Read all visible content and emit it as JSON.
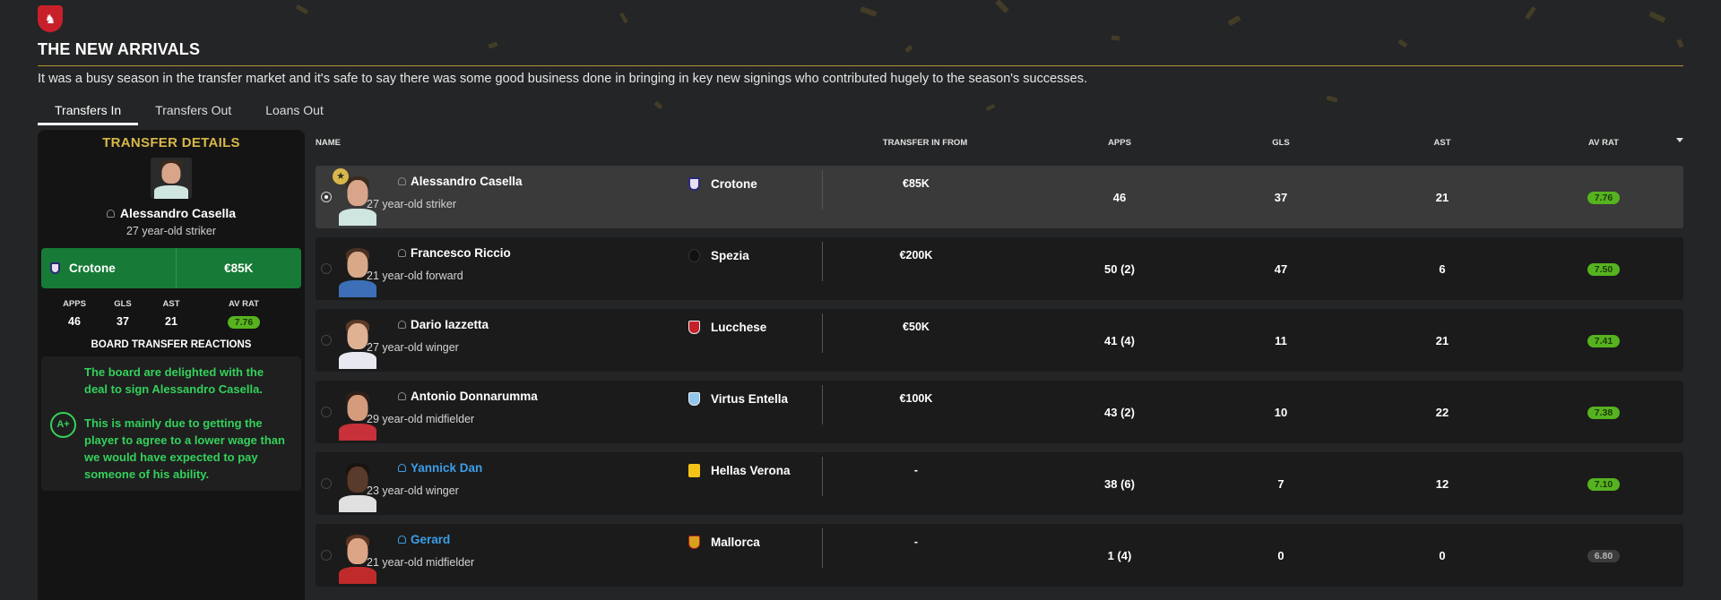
{
  "page": {
    "title": "THE NEW ARRIVALS",
    "intro": "It was a busy season in the transfer market and it's safe to say there was some good business done in bringing in key new signings who contributed hugely to the season's successes."
  },
  "tabs": [
    {
      "label": "Transfers In",
      "active": true
    },
    {
      "label": "Transfers Out",
      "active": false
    },
    {
      "label": "Loans Out",
      "active": false
    }
  ],
  "details": {
    "title": "TRANSFER DETAILS",
    "player_name": "Alessandro Casella",
    "player_desc": "27 year-old striker",
    "from_club": "Crotone",
    "fee": "€85K",
    "stats": [
      {
        "label": "APPS",
        "value": "46"
      },
      {
        "label": "GLS",
        "value": "37"
      },
      {
        "label": "AST",
        "value": "21"
      },
      {
        "label": "AV RAT",
        "value": "7.76"
      }
    ],
    "reactions_title": "BOARD TRANSFER REACTIONS",
    "grade": "A+",
    "reaction_1": "The board are delighted with the deal to sign Alessandro Casella.",
    "reaction_2": "This is mainly due to getting the player to agree to a lower wage than we would have expected to pay someone of his ability."
  },
  "table": {
    "headers": {
      "name": "NAME",
      "from": "TRANSFER IN FROM",
      "apps": "APPS",
      "gls": "GLS",
      "ast": "AST",
      "rat": "AV RAT"
    },
    "rows": [
      {
        "name": "Alessandro Casella",
        "desc": "27 year-old striker",
        "club": "Crotone",
        "fee": "€85K",
        "apps": "46",
        "gls": "37",
        "ast": "21",
        "rat": "7.76"
      },
      {
        "name": "Francesco Riccio",
        "desc": "21 year-old forward",
        "club": "Spezia",
        "fee": "€200K",
        "apps": "50 (2)",
        "gls": "47",
        "ast": "6",
        "rat": "7.50"
      },
      {
        "name": "Dario Iazzetta",
        "desc": "27 year-old winger",
        "club": "Lucchese",
        "fee": "€50K",
        "apps": "41 (4)",
        "gls": "11",
        "ast": "21",
        "rat": "7.41"
      },
      {
        "name": "Antonio Donnarumma",
        "desc": "29 year-old midfielder",
        "club": "Virtus Entella",
        "fee": "€100K",
        "apps": "43 (2)",
        "gls": "10",
        "ast": "22",
        "rat": "7.38"
      },
      {
        "name": "Yannick Dan",
        "desc": "23 year-old winger",
        "club": "Hellas Verona",
        "fee": "-",
        "apps": "38 (6)",
        "gls": "7",
        "ast": "12",
        "rat": "7.10"
      },
      {
        "name": "Gerard",
        "desc": "21 year-old midfielder",
        "club": "Mallorca",
        "fee": "-",
        "apps": "1 (4)",
        "gls": "0",
        "ast": "0",
        "rat": "6.80"
      }
    ]
  },
  "colors": {
    "accent_gold": "#d9b74a",
    "deal_green": "#177a36",
    "reaction_green": "#33d15b",
    "rating_green": "#56b31f",
    "link_blue": "#3d9ee8"
  }
}
